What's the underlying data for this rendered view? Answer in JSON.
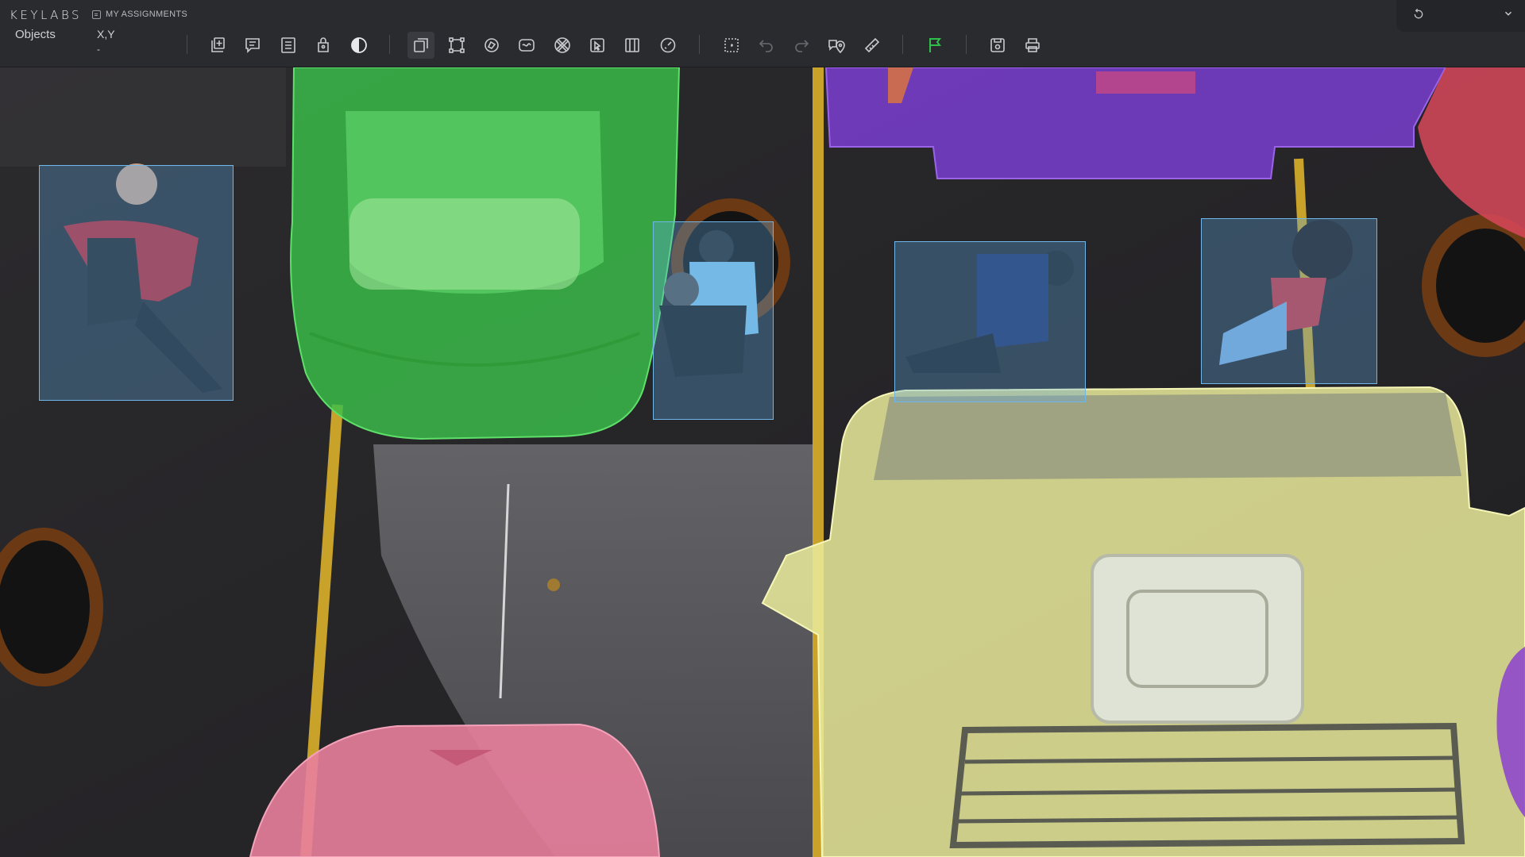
{
  "app": {
    "brand": "KEYLABS",
    "assignments_label": "MY ASSIGNMENTS"
  },
  "toolbar": {
    "objects_tab": "Objects",
    "xy_label": "X,Y",
    "xy_value": "-",
    "tools": [
      "new-object-icon",
      "comment-icon",
      "list-icon",
      "mask-icon",
      "contrast-icon",
      "copy-frame-icon",
      "points-icon",
      "polygon-icon",
      "brush-icon",
      "pattern-icon",
      "smart-select-icon",
      "grid-icon",
      "timer-icon",
      "selection-box-icon",
      "undo-icon",
      "redo-icon",
      "location-comment-icon",
      "ruler-icon",
      "flag-icon",
      "save-icon",
      "print-icon"
    ],
    "flag_color": "#2fbf4a"
  },
  "annotations": {
    "bbox_color": "#6fb6ea",
    "mask_colors": {
      "car_green": "#3bc04a",
      "truck_purple": "#7a3ed0",
      "truck_yellow": "#e9ea9a",
      "car_pink": "#e9809d",
      "car_red": "#d8485a"
    },
    "person_boxes_count": 4
  }
}
